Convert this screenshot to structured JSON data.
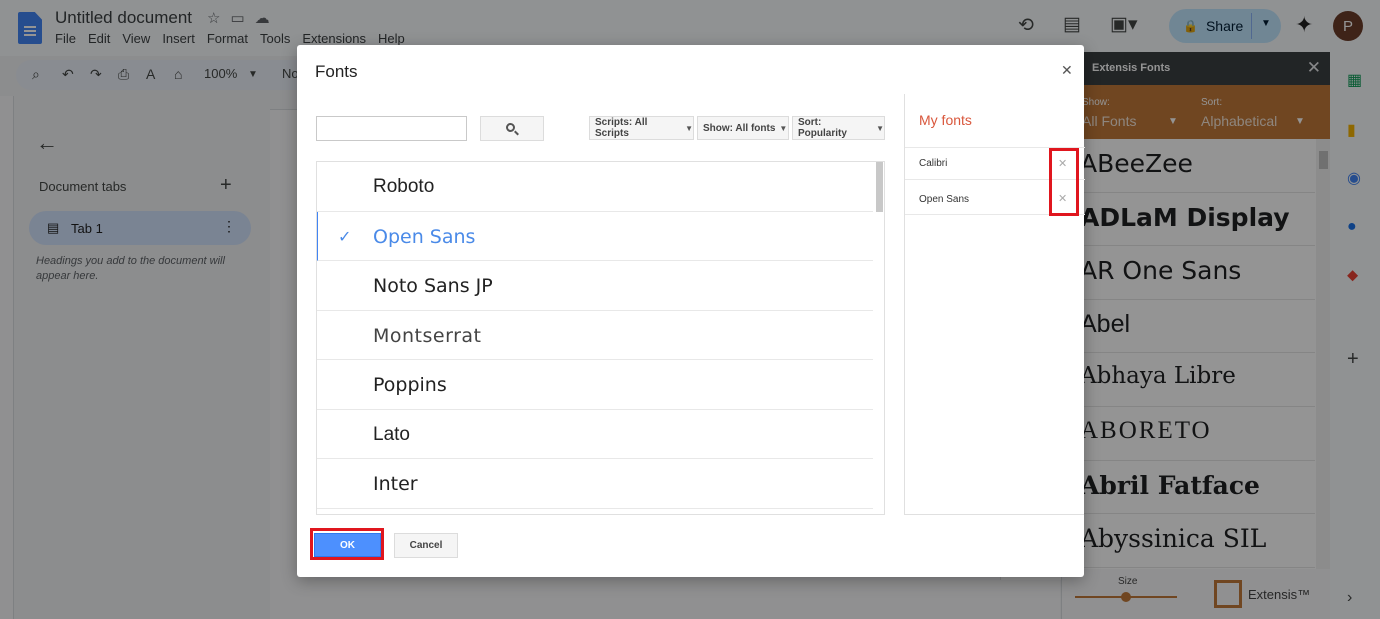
{
  "docs": {
    "title": "Untitled document",
    "menu": [
      "File",
      "Edit",
      "View",
      "Insert",
      "Format",
      "Tools",
      "Extensions",
      "Help"
    ],
    "share_label": "Share",
    "avatar_letter": "P",
    "zoom": "100%",
    "toolbar_trunc": "No",
    "left_panel": {
      "tabs_heading": "Document tabs",
      "tab1_label": "Tab 1",
      "hint": "Headings you add to the document will appear here."
    }
  },
  "extensis": {
    "header": "Extensis Fonts",
    "show_label": "Show:",
    "show_value": "All Fonts",
    "sort_label": "Sort:",
    "sort_value": "Alphabetical",
    "fonts": [
      "ABeeZee",
      "ADLaM Display",
      "AR One Sans",
      "Abel",
      "Abhaya Libre",
      "ABORETO",
      "Abril Fatface",
      "Abyssinica SIL"
    ],
    "size_label": "Size",
    "size_level": 0.5,
    "brand": "Extensis™"
  },
  "modal": {
    "title": "Fonts",
    "search_placeholder": "",
    "scripts_label": "Scripts: All Scripts",
    "show_label": "Show: All fonts",
    "sort_label": "Sort: Popularity",
    "fonts": [
      {
        "name": "Roboto",
        "selected": false
      },
      {
        "name": "Open Sans",
        "selected": true
      },
      {
        "name": "Noto Sans JP",
        "selected": false
      },
      {
        "name": "Montserrat",
        "selected": false
      },
      {
        "name": "Poppins",
        "selected": false
      },
      {
        "name": "Lato",
        "selected": false
      },
      {
        "name": "Inter",
        "selected": false
      }
    ],
    "my_fonts_heading": "My fonts",
    "my_fonts": [
      "Calibri",
      "Open Sans"
    ],
    "ok_label": "OK",
    "cancel_label": "Cancel"
  },
  "colors": {
    "accent": "#4d90fe",
    "my_fonts_heading": "#d9573c",
    "highlight": "#e0161e",
    "extensis_brand": "#c1793a"
  }
}
